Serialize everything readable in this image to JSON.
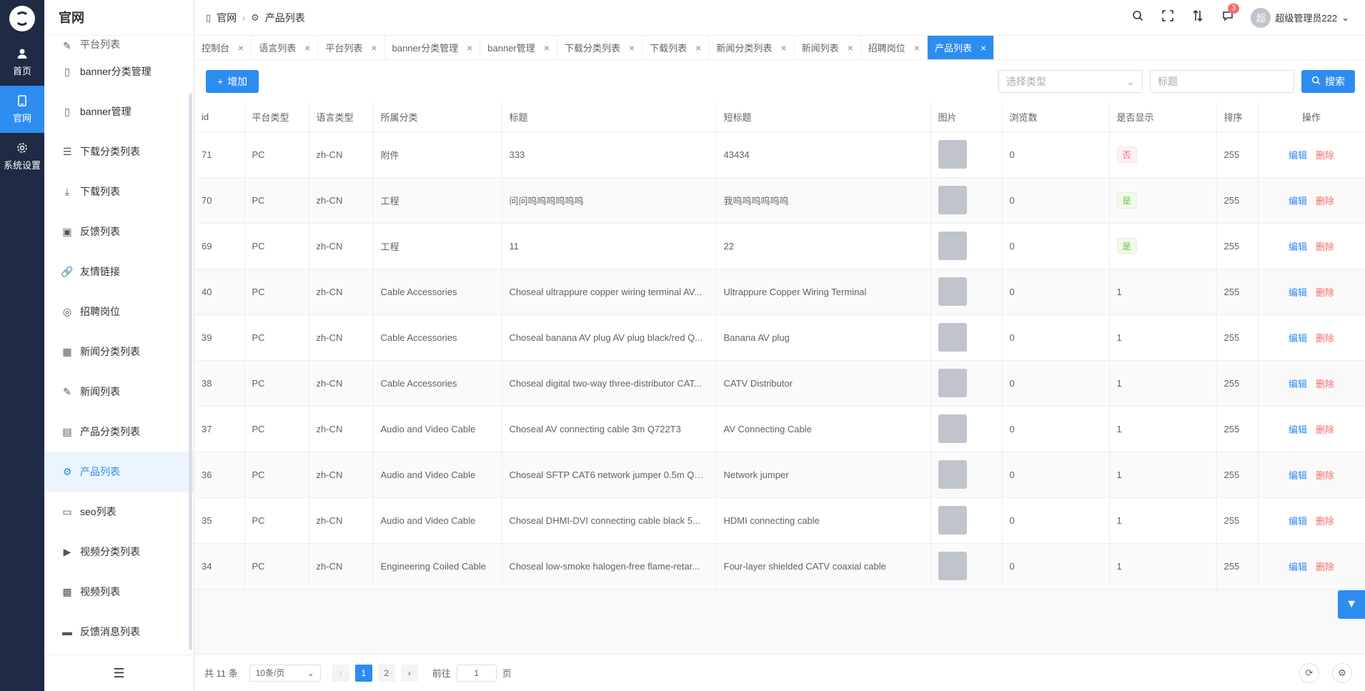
{
  "rail": {
    "items": [
      {
        "label": "首页",
        "icon": "user-icon"
      },
      {
        "label": "官网",
        "icon": "tablet-icon",
        "active": true
      },
      {
        "label": "系统设置",
        "icon": "gear-icon"
      }
    ]
  },
  "menu": {
    "title": "官网",
    "partial_label": "平台列表",
    "items": [
      {
        "label": "banner分类管理",
        "icon": "tablet-icon"
      },
      {
        "label": "banner管理",
        "icon": "tablet-icon"
      },
      {
        "label": "下载分类列表",
        "icon": "list-icon"
      },
      {
        "label": "下载列表",
        "icon": "download-icon"
      },
      {
        "label": "反馈列表",
        "icon": "book-icon"
      },
      {
        "label": "友情链接",
        "icon": "link-icon"
      },
      {
        "label": "招聘岗位",
        "icon": "globe-icon"
      },
      {
        "label": "新闻分类列表",
        "icon": "grid-icon"
      },
      {
        "label": "新闻列表",
        "icon": "pen-icon"
      },
      {
        "label": "产品分类列表",
        "icon": "phone-icon"
      },
      {
        "label": "产品列表",
        "icon": "chip-icon",
        "active": true
      },
      {
        "label": "seo列表",
        "icon": "box-icon"
      },
      {
        "label": "视频分类列表",
        "icon": "video-icon"
      },
      {
        "label": "视频列表",
        "icon": "apps-icon"
      },
      {
        "label": "反馈消息列表",
        "icon": "card-icon"
      }
    ]
  },
  "header": {
    "breadcrumb": [
      "官网",
      "产品列表"
    ],
    "notification_count": "3",
    "user_avatar_text": "超",
    "user_name": "超级管理员222"
  },
  "tabs": [
    "控制台",
    "语言列表",
    "平台列表",
    "banner分类管理",
    "banner管理",
    "下载分类列表",
    "下载列表",
    "新闻分类列表",
    "新闻列表",
    "招聘岗位",
    "产品列表"
  ],
  "active_tab": "产品列表",
  "toolbar": {
    "add_label": "增加",
    "type_placeholder": "选择类型",
    "title_placeholder": "标题",
    "search_label": "搜索"
  },
  "table": {
    "columns": [
      "id",
      "平台类型",
      "语言类型",
      "所属分类",
      "标题",
      "短标题",
      "图片",
      "浏览数",
      "是否显示",
      "排序",
      "操作"
    ],
    "edit_label": "编辑",
    "delete_label": "删除",
    "rows": [
      {
        "id": "71",
        "platform": "PC",
        "lang": "zh-CN",
        "category": "附件",
        "title": "333",
        "short": "43434",
        "views": "0",
        "show": "否",
        "show_type": "tag-no",
        "sort": "255"
      },
      {
        "id": "70",
        "platform": "PC",
        "lang": "zh-CN",
        "category": "工程",
        "title": "问问呜呜呜呜呜呜",
        "short": "我呜呜呜呜呜呜",
        "views": "0",
        "show": "是",
        "show_type": "tag-yes",
        "sort": "255"
      },
      {
        "id": "69",
        "platform": "PC",
        "lang": "zh-CN",
        "category": "工程",
        "title": "11",
        "short": "22",
        "views": "0",
        "show": "是",
        "show_type": "tag-yes",
        "sort": "255"
      },
      {
        "id": "40",
        "platform": "PC",
        "lang": "zh-CN",
        "category": "Cable Accessories",
        "title": "Choseal ultrappure copper wiring terminal AV...",
        "short": "Ultrappure Copper Wiring Terminal",
        "views": "0",
        "show": "1",
        "show_type": "",
        "sort": "255"
      },
      {
        "id": "39",
        "platform": "PC",
        "lang": "zh-CN",
        "category": "Cable Accessories",
        "title": "Choseal banana AV plug AV plug black/red Q...",
        "short": "Banana AV plug",
        "views": "0",
        "show": "1",
        "show_type": "",
        "sort": "255"
      },
      {
        "id": "38",
        "platform": "PC",
        "lang": "zh-CN",
        "category": "Cable Accessories",
        "title": "Choseal digital two-way three-distributor CAT...",
        "short": "CATV Distributor",
        "views": "0",
        "show": "1",
        "show_type": "",
        "sort": "255"
      },
      {
        "id": "37",
        "platform": "PC",
        "lang": "zh-CN",
        "category": "Audio and Video Cable",
        "title": "Choseal AV connecting cable 3m Q722T3",
        "short": "AV Connecting Cable",
        "views": "0",
        "show": "1",
        "show_type": "",
        "sort": "255"
      },
      {
        "id": "36",
        "platform": "PC",
        "lang": "zh-CN",
        "category": "Audio and Video Cable",
        "title": "Choseal SFTP CAT6 network jumper 0.5m Q56...",
        "short": "Network jumper",
        "views": "0",
        "show": "1",
        "show_type": "",
        "sort": "255"
      },
      {
        "id": "35",
        "platform": "PC",
        "lang": "zh-CN",
        "category": "Audio and Video Cable",
        "title": "Choseal DHMI-DVI connecting cable black 5...",
        "short": "HDMI connecting cable",
        "views": "0",
        "show": "1",
        "show_type": "",
        "sort": "255"
      },
      {
        "id": "34",
        "platform": "PC",
        "lang": "zh-CN",
        "category": "Engineering Coiled Cable",
        "title": "Choseal low-smoke halogen-free flame-retar...",
        "short": "Four-layer shielded CATV coaxial cable",
        "views": "0",
        "show": "1",
        "show_type": "",
        "sort": "255"
      }
    ]
  },
  "pagination": {
    "total_text": "共 11 条",
    "page_size": "10条/页",
    "pages": [
      "1",
      "2"
    ],
    "current": "1",
    "goto_prefix": "前往",
    "goto_value": "1",
    "goto_suffix": "页"
  }
}
